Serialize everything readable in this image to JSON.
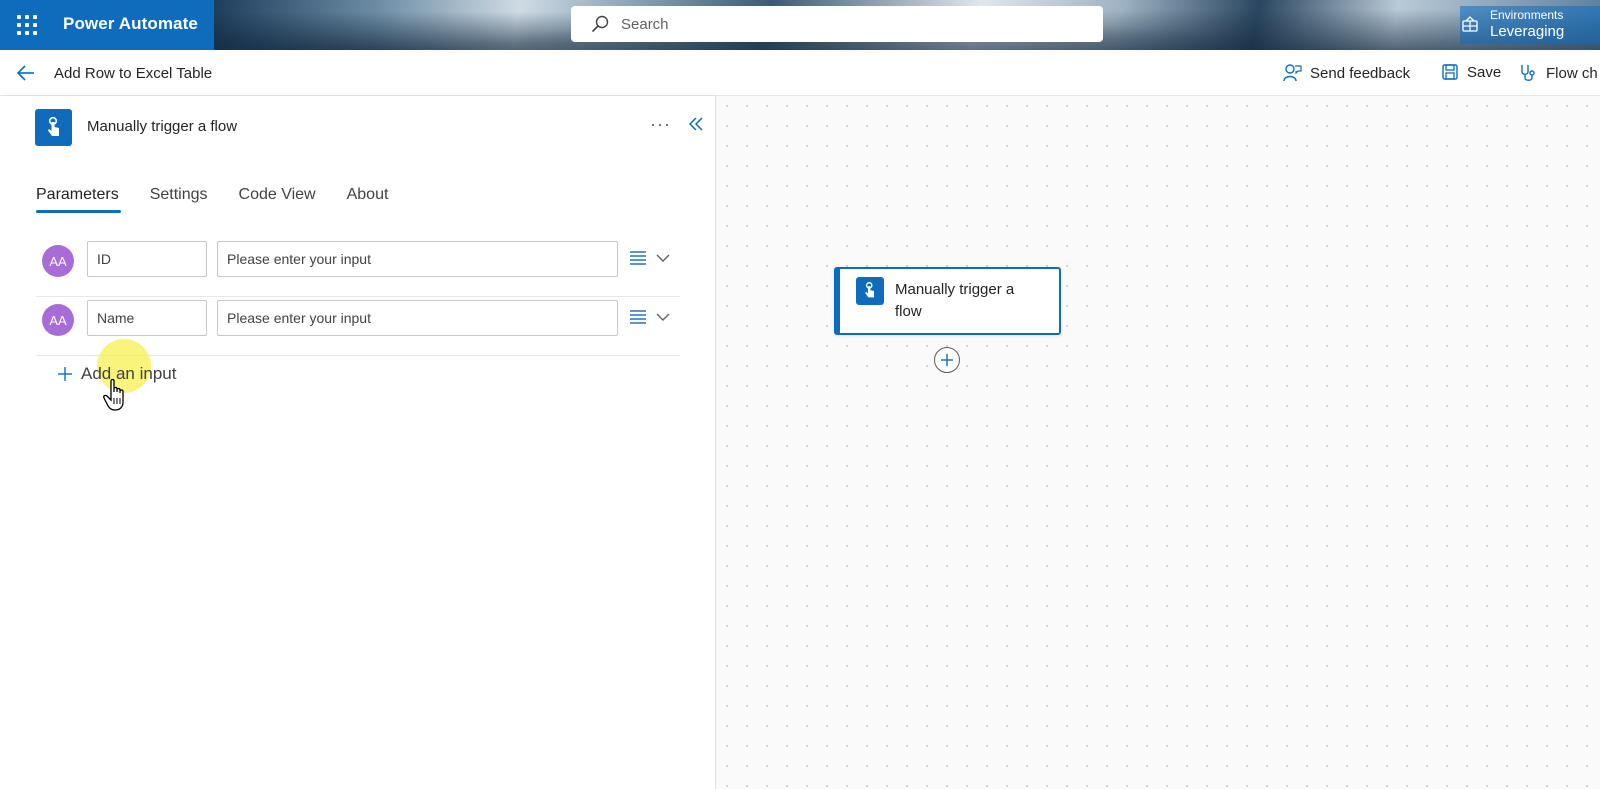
{
  "suitebar": {
    "app_title": "Power Automate",
    "search_placeholder": "Search",
    "environment_caption": "Environments",
    "environment_value": "Leveraging"
  },
  "commandbar": {
    "flow_name": "Add Row to Excel Table",
    "send_feedback": "Send feedback",
    "save": "Save",
    "flow_checker": "Flow ch"
  },
  "panel": {
    "trigger_title": "Manually trigger a flow",
    "more": "···",
    "tabs": [
      "Parameters",
      "Settings",
      "Code View",
      "About"
    ],
    "active_tab": "Parameters",
    "params": [
      {
        "avatar": "AA",
        "name": "ID",
        "placeholder": "Please enter your input"
      },
      {
        "avatar": "AA",
        "name": "Name",
        "placeholder": "Please enter your input"
      }
    ],
    "add_input": "Add an input"
  },
  "canvas": {
    "node_title": "Manually trigger a flow"
  },
  "colors": {
    "accent": "#0f6cbd",
    "avatar": "#a86cd8"
  }
}
